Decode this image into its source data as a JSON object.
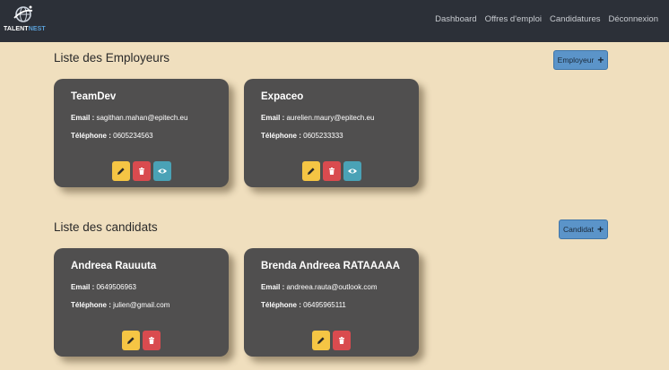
{
  "brand": {
    "name_part1": "TALENT",
    "name_part2": "NEST",
    "logo_icon": "globe-logo-icon"
  },
  "nav": {
    "items": [
      {
        "label": "Dashboard"
      },
      {
        "label": "Offres d'emploi"
      },
      {
        "label": "Candidatures"
      },
      {
        "label": "Déconnexion"
      }
    ]
  },
  "employers": {
    "title": "Liste des Employeurs",
    "add_label": "Employeur",
    "cards": [
      {
        "name": "TeamDev",
        "email_label": "Email :",
        "email": "sagithan.mahan@epitech.eu",
        "phone_label": "Téléphone :",
        "phone": "0605234563"
      },
      {
        "name": "Expaceo",
        "email_label": "Email :",
        "email": "aurelien.maury@epitech.eu",
        "phone_label": "Téléphone :",
        "phone": "0605233333"
      }
    ]
  },
  "candidates": {
    "title": "Liste des candidats",
    "add_label": "Candidat",
    "cards": [
      {
        "name": "Andreea Rauuuta",
        "email_label": "Email :",
        "email": "0649506963",
        "phone_label": "Téléphone :",
        "phone": "julien@gmail.com"
      },
      {
        "name": "Brenda Andreea RATAAAAA",
        "email_label": "Email :",
        "email": "andreea.rauta@outlook.com",
        "phone_label": "Téléphone :",
        "phone": "06495965111"
      }
    ]
  },
  "colors": {
    "navbar": "#2c3038",
    "background": "#f0dfbe",
    "card": "#504f4f",
    "edit": "#f5c544",
    "delete": "#d94b4f",
    "view": "#4aa2b6",
    "add_button": "#5b94c9"
  }
}
